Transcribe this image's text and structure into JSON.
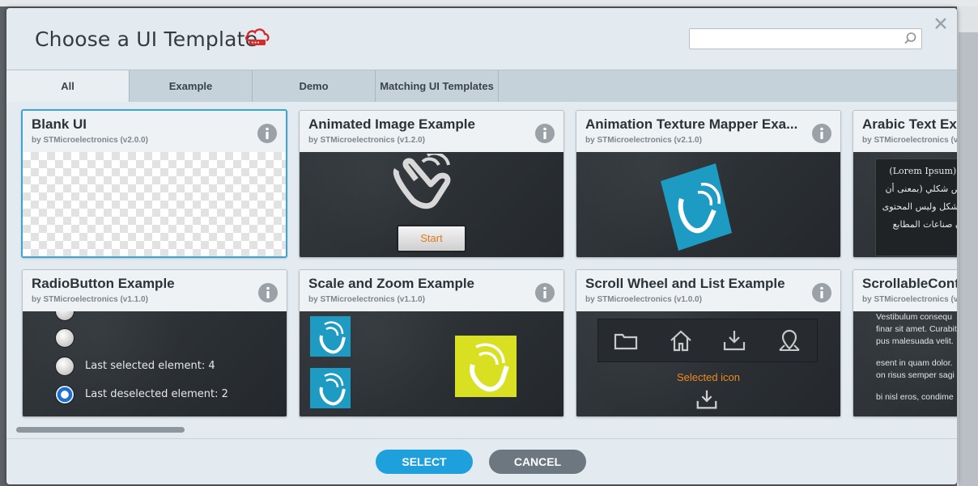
{
  "dialog": {
    "title": "Choose a UI Template",
    "title_icon": "cloud-icon",
    "close_icon": "close-icon",
    "search": {
      "placeholder": "",
      "value": "",
      "icon": "search-icon"
    }
  },
  "tabs": [
    {
      "label": "All",
      "active": true
    },
    {
      "label": "Example",
      "active": false
    },
    {
      "label": "Demo",
      "active": false
    },
    {
      "label": "Matching UI Templates",
      "active": false
    }
  ],
  "templates": [
    {
      "title": "Blank UI",
      "subtitle": "by STMicroelectronics (v2.0.0)",
      "selected": true
    },
    {
      "title": "Animated Image Example",
      "subtitle": "by STMicroelectronics (v1.2.0)",
      "preview_button": "Start"
    },
    {
      "title": "Animation Texture Mapper Exa...",
      "subtitle": "by STMicroelectronics (v2.1.0)"
    },
    {
      "title": "Arabic Text Exa",
      "subtitle": "by STMicroelectronics (v",
      "preview_lines": [
        "(Lorem Ipsum)م",
        "ص شكلي (بمعنى أن",
        "شكل وليس المحتوى)",
        "ن صناعات المطابع",
        "إ"
      ]
    },
    {
      "title": "RadioButton Example",
      "subtitle": "by STMicroelectronics (v1.1.0)",
      "preview_lines": [
        "Last selected element: 4",
        "Last deselected element: 2"
      ]
    },
    {
      "title": "Scale and Zoom Example",
      "subtitle": "by STMicroelectronics (v1.1.0)"
    },
    {
      "title": "Scroll Wheel and List Example",
      "subtitle": "by STMicroelectronics (v1.0.0)",
      "preview_label": "Selected icon"
    },
    {
      "title": "ScrollableCont",
      "subtitle": "by STMicroelectronics (v",
      "preview_lines": [
        "Vestibulum consequ",
        "finar sit amet. Curabit",
        "pus malesuada velit.",
        "esent in quam dolor.",
        "on risus semper sagi",
        "bi nisl eros, condime"
      ]
    }
  ],
  "footer": {
    "select_label": "SELECT",
    "cancel_label": "CANCEL"
  },
  "colors": {
    "accent": "#1ea0dc",
    "cancel": "#6d7780",
    "selected_border": "#3aa4db",
    "highlight_orange": "#f08a1a"
  }
}
